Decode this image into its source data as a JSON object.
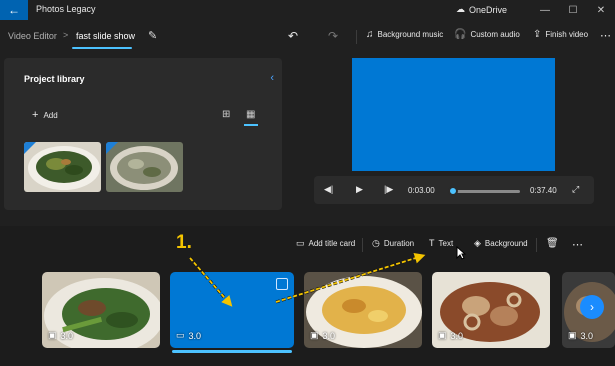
{
  "titlebar": {
    "app_title": "Photos Legacy",
    "cloud_label": "OneDrive"
  },
  "breadcrumb": {
    "root": "Video Editor",
    "separator": ">",
    "current": "fast slide show"
  },
  "toolbar": {
    "background_music": "Background music",
    "custom_audio": "Custom audio",
    "finish_video": "Finish video"
  },
  "library": {
    "title": "Project library",
    "add_label": "Add"
  },
  "player": {
    "current_time": "0:03.00",
    "total_time": "0:37.40",
    "progress": 0.08
  },
  "storyboard": {
    "add_title_card": "Add title card",
    "duration": "Duration",
    "text": "Text",
    "background": "Background",
    "clips": [
      {
        "duration": "3.0"
      },
      {
        "duration": "3.0"
      },
      {
        "duration": "3.0"
      },
      {
        "duration": "3.0"
      },
      {
        "duration": "3.0"
      }
    ]
  },
  "annotation": {
    "step_label": "1."
  },
  "colors": {
    "accent": "#0078d4",
    "highlight": "#4cc2ff",
    "arrow": "#f4c400"
  }
}
